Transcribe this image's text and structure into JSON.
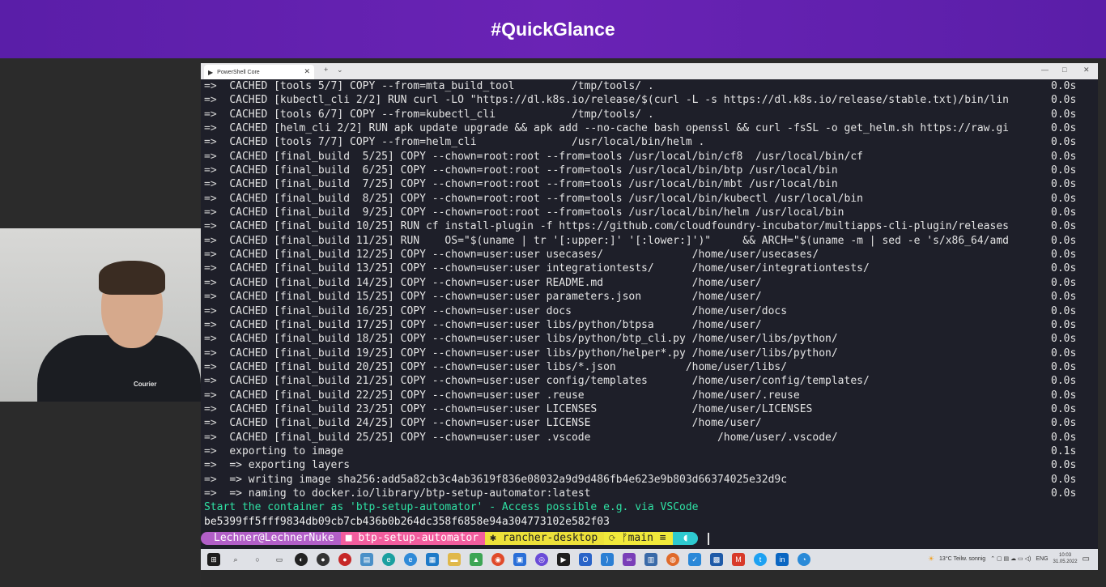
{
  "banner": {
    "title": "#QuickGlance"
  },
  "webcam": {
    "shirt_text": "Courier"
  },
  "window": {
    "tab_title": "PowerShell Core",
    "tab_close": "✕",
    "new_tab": "+",
    "dropdown": "⌄",
    "minimize": "—",
    "maximize": "□",
    "close": "✕"
  },
  "terminal": {
    "arrow": "=>",
    "lines": [
      {
        "text": "CACHED [tools 5/7] COPY --from=mta_build_tool         /tmp/tools/ .",
        "dur": "0.0s"
      },
      {
        "text": "CACHED [kubectl_cli 2/2] RUN curl -LO \"https://dl.k8s.io/release/$(curl -L -s https://dl.k8s.io/release/stable.txt)/bin/lin",
        "dur": "0.0s"
      },
      {
        "text": "CACHED [tools 6/7] COPY --from=kubectl_cli            /tmp/tools/ .",
        "dur": "0.0s"
      },
      {
        "text": "CACHED [helm_cli 2/2] RUN apk update upgrade && apk add --no-cache bash openssl && curl -fsSL -o get_helm.sh https://raw.gi",
        "dur": "0.0s"
      },
      {
        "text": "CACHED [tools 7/7] COPY --from=helm_cli               /usr/local/bin/helm .",
        "dur": "0.0s"
      },
      {
        "text": "CACHED [final_build  5/25] COPY --chown=root:root --from=tools /usr/local/bin/cf8  /usr/local/bin/cf",
        "dur": "0.0s"
      },
      {
        "text": "CACHED [final_build  6/25] COPY --chown=root:root --from=tools /usr/local/bin/btp /usr/local/bin",
        "dur": "0.0s"
      },
      {
        "text": "CACHED [final_build  7/25] COPY --chown=root:root --from=tools /usr/local/bin/mbt /usr/local/bin",
        "dur": "0.0s"
      },
      {
        "text": "CACHED [final_build  8/25] COPY --chown=root:root --from=tools /usr/local/bin/kubectl /usr/local/bin",
        "dur": "0.0s"
      },
      {
        "text": "CACHED [final_build  9/25] COPY --chown=root:root --from=tools /usr/local/bin/helm /usr/local/bin",
        "dur": "0.0s"
      },
      {
        "text": "CACHED [final_build 10/25] RUN cf install-plugin -f https://github.com/cloudfoundry-incubator/multiapps-cli-plugin/releases",
        "dur": "0.0s"
      },
      {
        "text": "CACHED [final_build 11/25] RUN    OS=\"$(uname | tr '[:upper:]' '[:lower:]')\"     && ARCH=\"$(uname -m | sed -e 's/x86_64/amd",
        "dur": "0.0s"
      },
      {
        "text": "CACHED [final_build 12/25] COPY --chown=user:user usecases/              /home/user/usecases/",
        "dur": "0.0s"
      },
      {
        "text": "CACHED [final_build 13/25] COPY --chown=user:user integrationtests/      /home/user/integrationtests/",
        "dur": "0.0s"
      },
      {
        "text": "CACHED [final_build 14/25] COPY --chown=user:user README.md              /home/user/",
        "dur": "0.0s"
      },
      {
        "text": "CACHED [final_build 15/25] COPY --chown=user:user parameters.json        /home/user/",
        "dur": "0.0s"
      },
      {
        "text": "CACHED [final_build 16/25] COPY --chown=user:user docs                   /home/user/docs",
        "dur": "0.0s"
      },
      {
        "text": "CACHED [final_build 17/25] COPY --chown=user:user libs/python/btpsa      /home/user/",
        "dur": "0.0s"
      },
      {
        "text": "CACHED [final_build 18/25] COPY --chown=user:user libs/python/btp_cli.py /home/user/libs/python/",
        "dur": "0.0s"
      },
      {
        "text": "CACHED [final_build 19/25] COPY --chown=user:user libs/python/helper*.py /home/user/libs/python/",
        "dur": "0.0s"
      },
      {
        "text": "CACHED [final_build 20/25] COPY --chown=user:user libs/*.json           /home/user/libs/",
        "dur": "0.0s"
      },
      {
        "text": "CACHED [final_build 21/25] COPY --chown=user:user config/templates       /home/user/config/templates/",
        "dur": "0.0s"
      },
      {
        "text": "CACHED [final_build 22/25] COPY --chown=user:user .reuse                 /home/user/.reuse",
        "dur": "0.0s"
      },
      {
        "text": "CACHED [final_build 23/25] COPY --chown=user:user LICENSES               /home/user/LICENSES",
        "dur": "0.0s"
      },
      {
        "text": "CACHED [final_build 24/25] COPY --chown=user:user LICENSE                /home/user/",
        "dur": "0.0s"
      },
      {
        "text": "CACHED [final_build 25/25] COPY --chown=user:user .vscode                    /home/user/.vscode/",
        "dur": "0.0s"
      },
      {
        "text": "exporting to image",
        "dur": "0.1s"
      },
      {
        "text": "=> exporting layers",
        "dur": "0.0s"
      },
      {
        "text": "=> writing image sha256:add5a82cb3c4ab3619f836e08032a9d9d486fb4e623e9b803d66374025e32d9c",
        "dur": "0.0s"
      },
      {
        "text": "=> naming to docker.io/library/btp-setup-automator:latest",
        "dur": "0.0s"
      }
    ],
    "message": "Start the container as 'btp-setup-automator' - Access possible e.g. via VSCode",
    "container_id": "be5399ff5fff9834db09cb7cb436b0b264dc358f6858e94a304773102e582f03"
  },
  "prompt": {
    "user": "Lechner@LechnerNuke",
    "path": "btp-setup-automator",
    "k8s": "rancher-desktop",
    "git": "main ≡",
    "git_icon": "⟳ ᚠ",
    "folder_icon": "■",
    "k8s_icon": "✱",
    "end_icon": "◖"
  },
  "taskbar": {
    "weather": "13°C  Teilw. sonnig",
    "language": "ENG",
    "time": "10:03",
    "date": "31.05.2022",
    "tray_icons": "⌃ ▢ ▤ ☁ ▭ ◁)"
  }
}
